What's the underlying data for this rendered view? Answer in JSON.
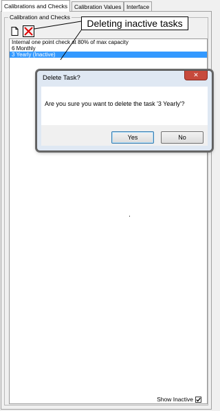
{
  "tabs": [
    {
      "label": "Calibrations and Checks",
      "active": true
    },
    {
      "label": "Calibration Values",
      "active": false
    },
    {
      "label": "Interface",
      "active": false
    }
  ],
  "group": {
    "legend": "Calibration and Checks"
  },
  "toolbar": {
    "new_icon": "new-document-icon",
    "delete_icon": "delete-x-icon",
    "delete_color": "#e00000"
  },
  "callout": {
    "text": "Deleting inactive tasks"
  },
  "tasks": [
    {
      "label": "Internal one point check at 80% of max capacity",
      "selected": false
    },
    {
      "label": "6 Monthly",
      "selected": false
    },
    {
      "label": "3 Yearly (Inactive)",
      "selected": true
    }
  ],
  "show_inactive": {
    "label": "Show Inactive",
    "checked": true
  },
  "dialog": {
    "title": "Delete Task?",
    "message": "Are you sure you want to delete the task '3 Yearly'?",
    "yes_label": "Yes",
    "no_label": "No",
    "close_icon": "close-icon"
  },
  "colors": {
    "selection": "#3399ff",
    "close_button": "#c74a3c"
  }
}
